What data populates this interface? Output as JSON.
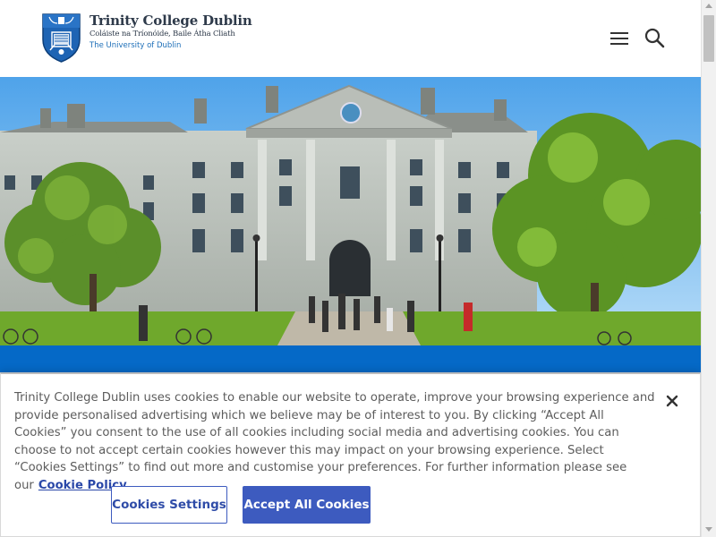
{
  "header": {
    "logo_title": "Trinity College Dublin",
    "logo_irish": "Coláiste na Tríonóide, Baile Átha Cliath",
    "logo_subtitle": "The University of Dublin",
    "menu_icon": "hamburger-menu-icon",
    "search_icon": "search-icon"
  },
  "hero": {
    "description_icon": "campus-building-photo"
  },
  "cookie_banner": {
    "message": "Trinity College Dublin uses cookies to enable our website to operate, improve your browsing experience and provide personalised advertising which we believe may be of interest to you. By clicking “Accept All Cookies” you consent to the use of all cookies including social media and advertising cookies. You can choose to not accept certain cookies however this may impact on your browsing experience. Select “Cookies Settings” to find out more and customise your preferences. For further information please see our",
    "policy_link": "Cookie Policy",
    "settings_label": "Cookies Settings",
    "accept_label": "Accept All Cookies",
    "close_icon": "close-icon"
  },
  "colors": {
    "brand_blue": "#0569c7",
    "button_blue": "#3d5bbf",
    "link_blue": "#2a48a8",
    "logo_text": "#2e3a4a"
  }
}
